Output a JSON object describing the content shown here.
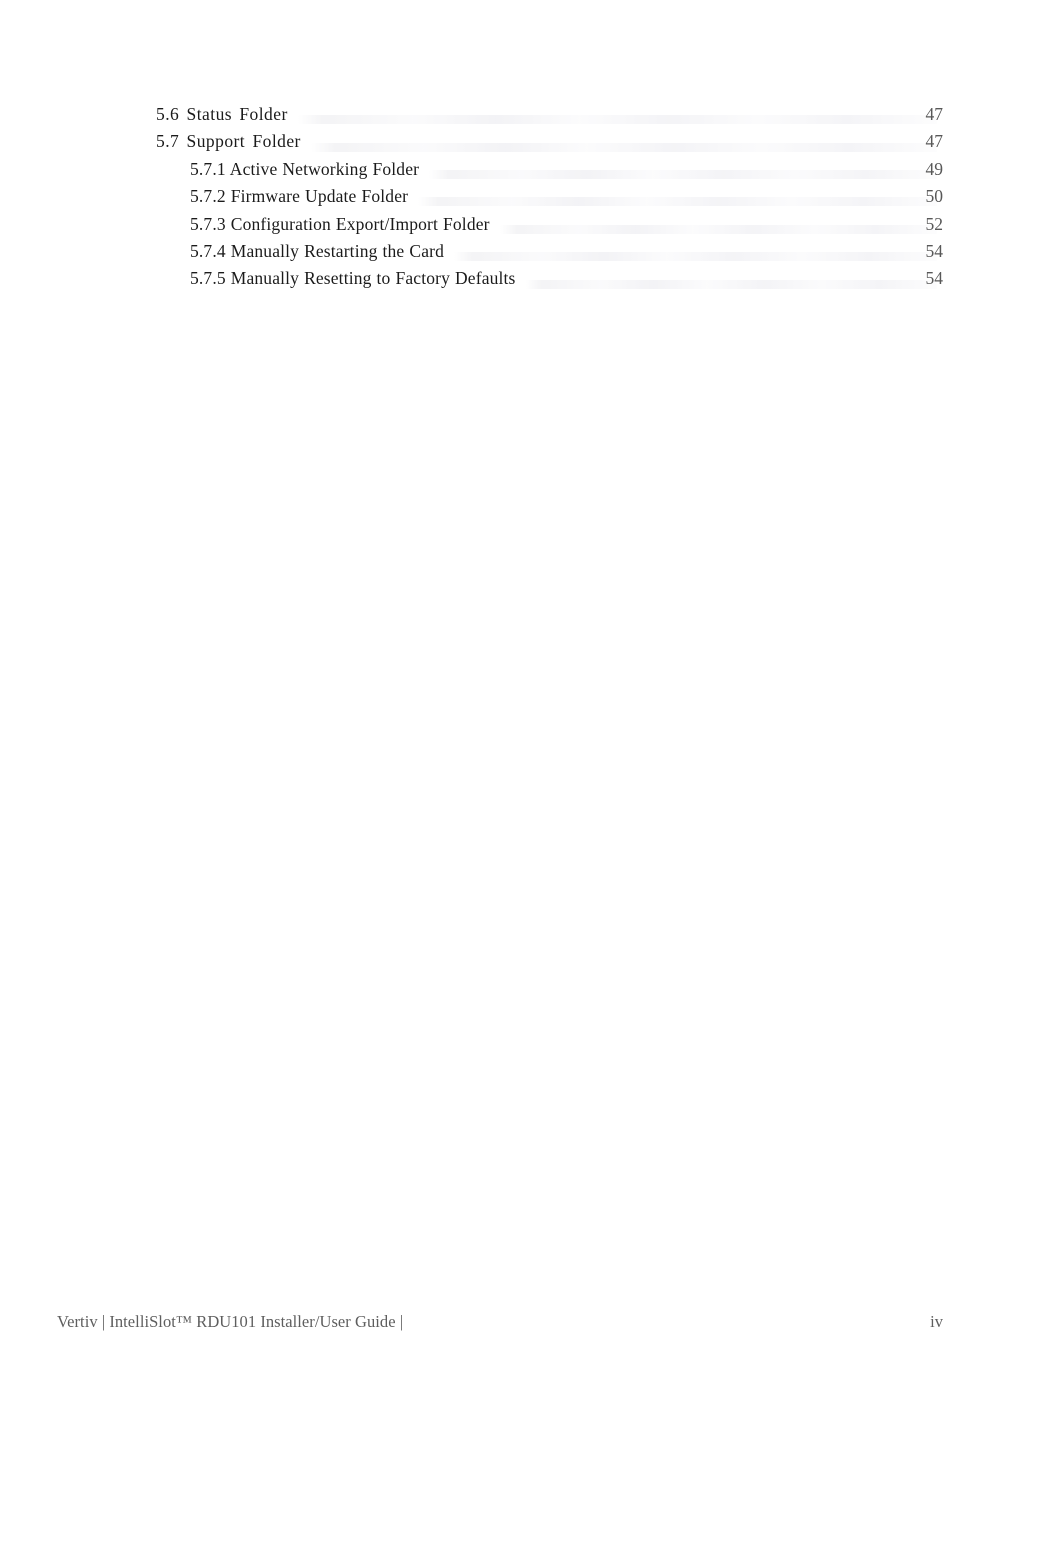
{
  "document": {
    "type": "table-of-contents"
  },
  "toc": {
    "entries": [
      {
        "label": "5.6 Status Folder",
        "page": "47",
        "level": 1
      },
      {
        "label": "5.7 Support Folder",
        "page": "47",
        "level": 1
      },
      {
        "label": "5.7.1 Active Networking Folder",
        "page": "49",
        "level": 2
      },
      {
        "label": "5.7.2 Firmware Update Folder",
        "page": "50",
        "level": 2
      },
      {
        "label": "5.7.3 Configuration Export/Import Folder",
        "page": "52",
        "level": 2
      },
      {
        "label": "5.7.4 Manually Restarting the Card",
        "page": "54",
        "level": 2
      },
      {
        "label": "5.7.5 Manually Resetting to Factory Defaults",
        "page": "54",
        "level": 2
      }
    ]
  },
  "footer": {
    "text": "Vertiv | IntelliSlot™ RDU101 Installer/User Guide |",
    "page": "iv"
  },
  "colors": {
    "text": "#1b1b1b",
    "page_number": "#585858",
    "footer": "#5e5e5e",
    "leader": "#f4f4f6",
    "background": "#ffffff"
  }
}
